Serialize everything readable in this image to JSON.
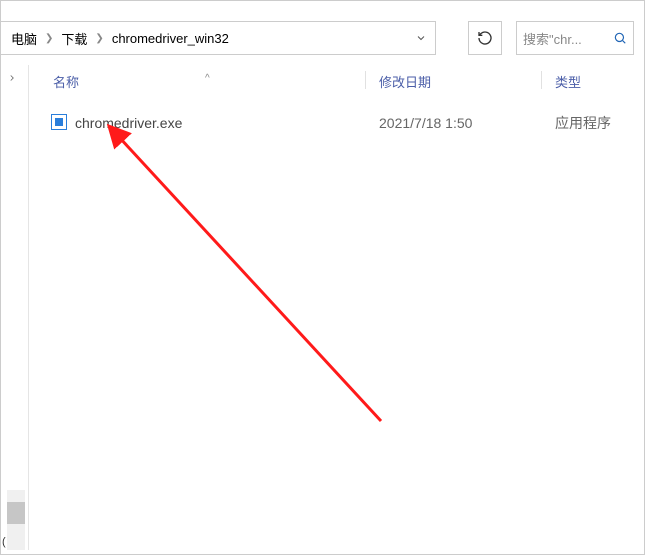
{
  "breadcrumb": {
    "items": [
      {
        "label": "电脑"
      },
      {
        "label": "下载"
      },
      {
        "label": "chromedriver_win32"
      }
    ]
  },
  "search": {
    "placeholder": "搜索\"chr..."
  },
  "columns": {
    "name": "名称",
    "date": "修改日期",
    "type": "类型",
    "sort_indicator": "^"
  },
  "files": [
    {
      "icon": "exe-icon",
      "name": "chromedriver.exe",
      "date": "2021/7/18 1:50",
      "type": "应用程序"
    }
  ],
  "left_strip": {
    "tiny_label": "("
  }
}
